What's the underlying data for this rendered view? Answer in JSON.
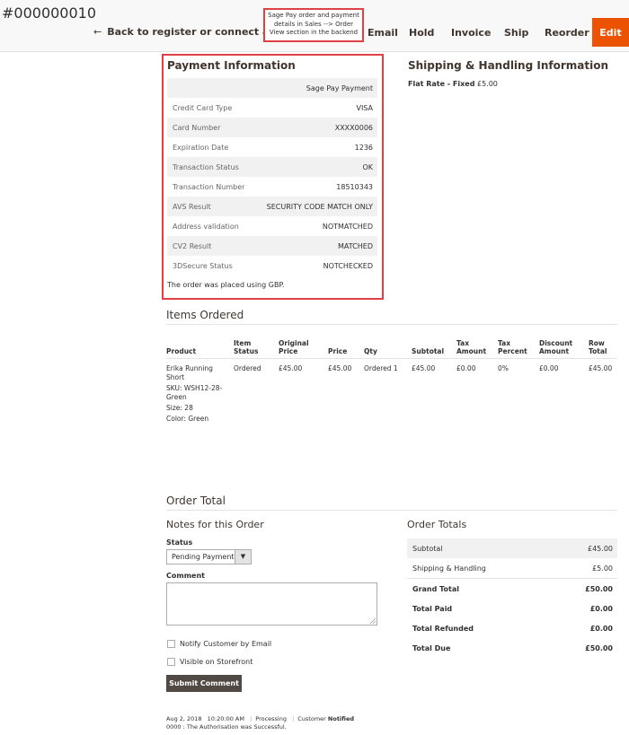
{
  "header": {
    "order_id": "#000000010",
    "back_label": "Back to register or connect an account",
    "actions": [
      "Email",
      "Hold",
      "Invoice",
      "Ship",
      "Reorder"
    ],
    "edit_label": "Edit",
    "edit_color": "#eb5202"
  },
  "callout": {
    "lines": [
      "Sage Pay order and payment",
      "details in Sales --> Order",
      "View section in the backend"
    ]
  },
  "payment": {
    "title": "Payment Information",
    "method": "Sage Pay Payment",
    "rows": [
      {
        "label": "Credit Card Type",
        "value": "VISA"
      },
      {
        "label": "Card Number",
        "value": "XXXX0006"
      },
      {
        "label": "Expiration Date",
        "value": "1236"
      },
      {
        "label": "Transaction Status",
        "value": "OK"
      },
      {
        "label": "Transaction Number",
        "value": "18510343"
      },
      {
        "label": "AVS Result",
        "value": "SECURITY CODE MATCH ONLY"
      },
      {
        "label": "Address validation",
        "value": "NOTMATCHED"
      },
      {
        "label": "CV2 Result",
        "value": "MATCHED"
      },
      {
        "label": "3DSecure Status",
        "value": "NOTCHECKED"
      }
    ],
    "currency_note": "The order was placed using GBP."
  },
  "shipping": {
    "title": "Shipping & Handling Information",
    "method_label": "Flat Rate - Fixed",
    "method_price": "£5.00"
  },
  "items": {
    "title": "Items Ordered",
    "headers": {
      "product": "Product",
      "item_status": [
        "Item",
        "Status"
      ],
      "original_price": [
        "Original",
        "Price"
      ],
      "price": "Price",
      "qty": "Qty",
      "subtotal": "Subtotal",
      "tax_amount": [
        "Tax",
        "Amount"
      ],
      "tax_percent": [
        "Tax",
        "Percent"
      ],
      "discount_amount": [
        "Discount",
        "Amount"
      ],
      "row_total": [
        "Row",
        "Total"
      ]
    },
    "row": {
      "product_name": [
        "Erika Running",
        "Short"
      ],
      "sku": [
        "SKU: WSH12-28-",
        "Green"
      ],
      "size": "Size: 28",
      "color": "Color: Green",
      "item_status": "Ordered",
      "original_price": "£45.00",
      "price": "£45.00",
      "qty": "Ordered 1",
      "subtotal": "£45.00",
      "tax_amount": "£0.00",
      "tax_percent": "0%",
      "discount_amount": "£0.00",
      "row_total": "£45.00"
    }
  },
  "order_total": {
    "title": "Order Total",
    "notes_title": "Notes for this Order",
    "status_label": "Status",
    "status_value": "Pending Payment",
    "comment_label": "Comment",
    "notify_label": "Notify Customer by Email",
    "visible_label": "Visible on Storefront",
    "submit_label": "Submit Comment",
    "history": {
      "date": "Aug 2, 2018",
      "time": "10:20:00 AM",
      "status": "Processing",
      "customer_label": "Customer",
      "customer_state": "Notified",
      "message": "0000 : The Authorisation was Successful."
    }
  },
  "totals": {
    "title": "Order Totals",
    "rows": [
      {
        "label": "Subtotal",
        "value": "£45.00"
      },
      {
        "label": "Shipping & Handling",
        "value": "£5.00"
      },
      {
        "label": "Grand Total",
        "value": "£50.00"
      },
      {
        "label": "Total Paid",
        "value": "£0.00"
      },
      {
        "label": "Total Refunded",
        "value": "£0.00"
      },
      {
        "label": "Total Due",
        "value": "£50.00"
      }
    ]
  }
}
